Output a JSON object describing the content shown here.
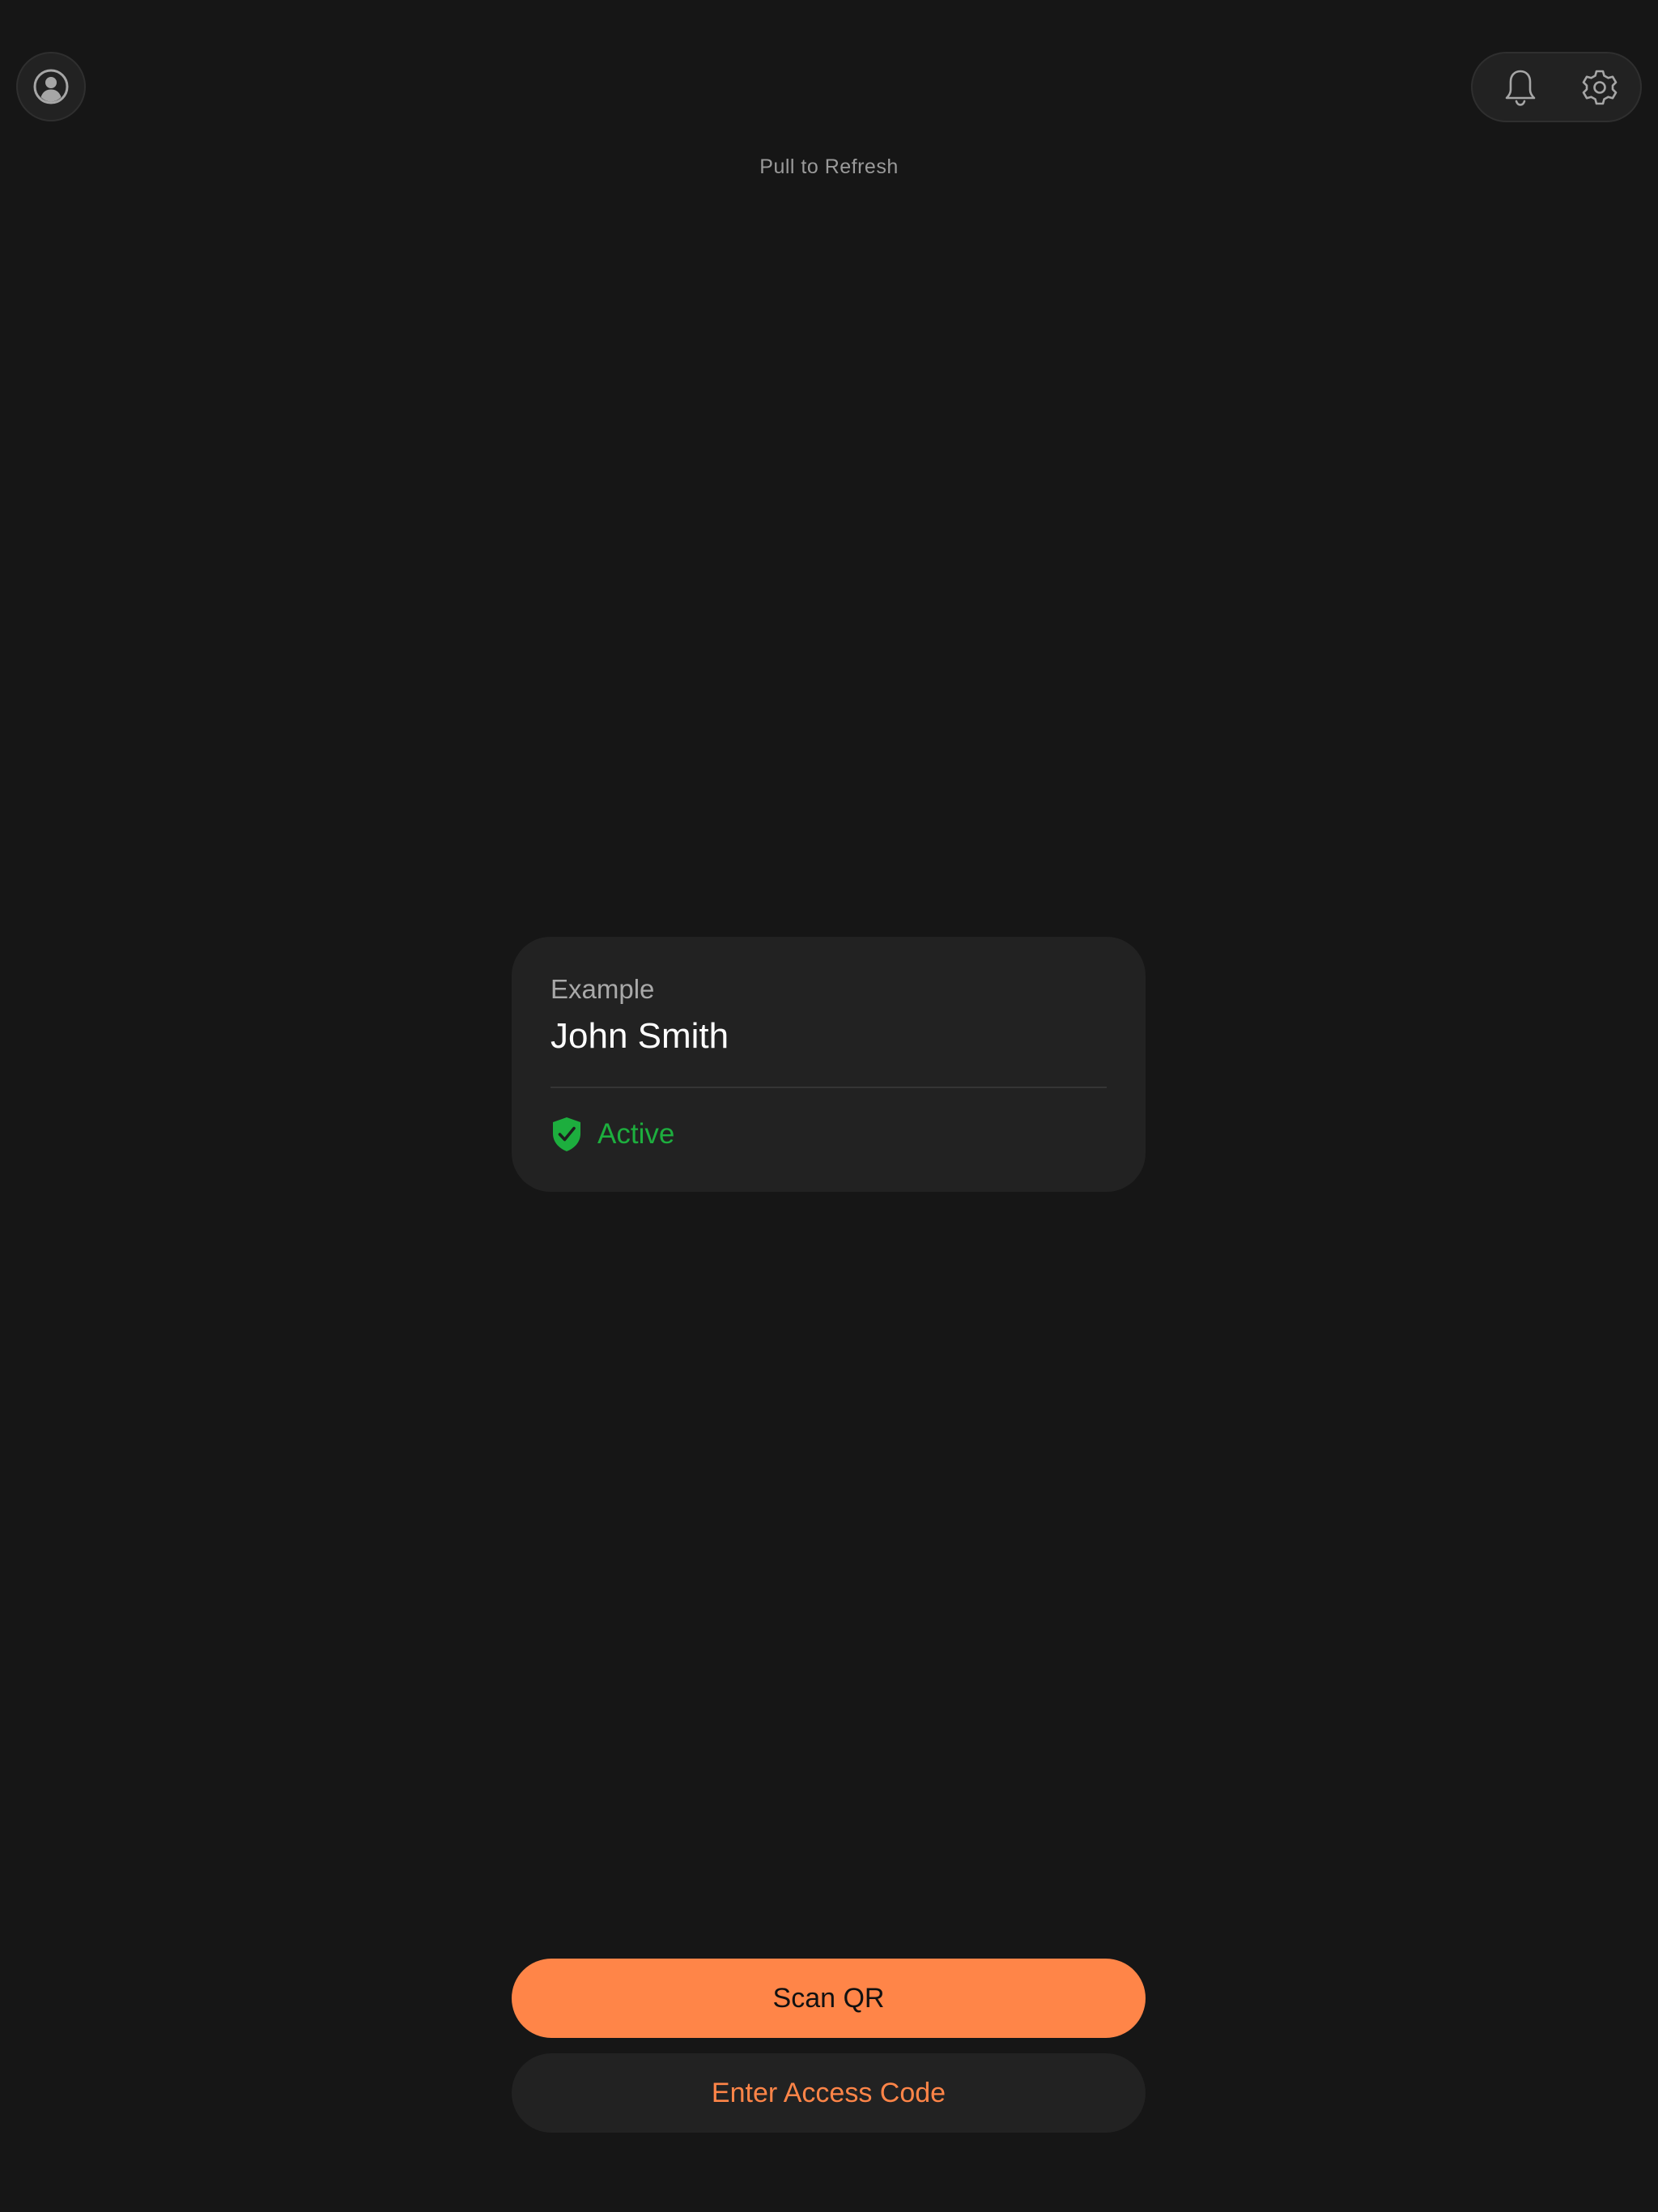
{
  "header": {
    "profile_icon": "person-circle-icon",
    "notifications_icon": "bell-icon",
    "settings_icon": "gear-icon",
    "refresh_hint": "Pull to Refresh"
  },
  "card": {
    "label": "Example",
    "name": "John Smith",
    "status": "Active",
    "status_icon": "shield-check-icon",
    "status_color": "#1dae3e"
  },
  "actions": {
    "scan_label": "Scan QR",
    "access_code_label": "Enter Access Code"
  },
  "colors": {
    "background": "#161616",
    "surface": "#222222",
    "accent": "#ff8548"
  }
}
